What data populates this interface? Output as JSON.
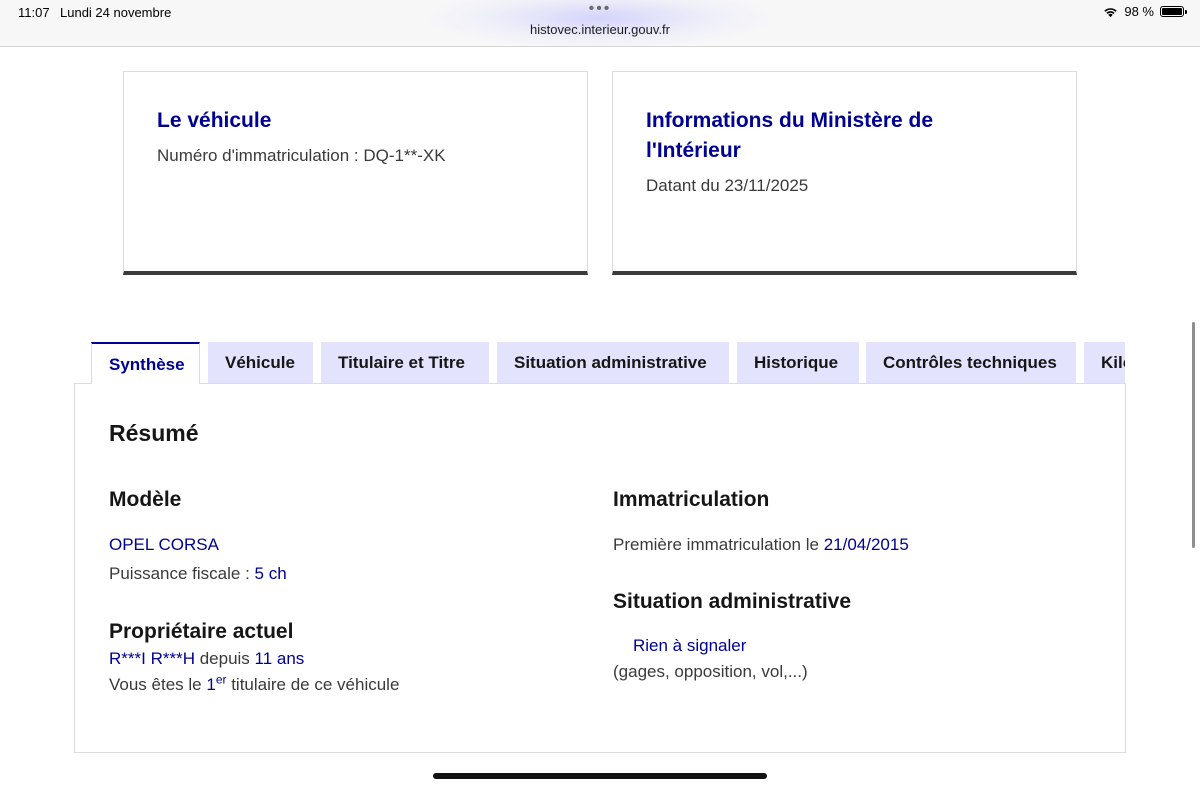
{
  "status_bar": {
    "time": "11:07",
    "date": "Lundi 24 novembre",
    "dots": "•••",
    "url": "histovec.interieur.gouv.fr",
    "battery_text": "98 %",
    "battery_level": 0.98,
    "wifi_icon": "wifi-icon",
    "battery_icon": "battery-icon"
  },
  "cards": {
    "vehicle": {
      "title": "Le véhicule",
      "plate_label": "Numéro d'immatriculation : DQ-1**-XK"
    },
    "ministry": {
      "title": "Informations du Ministère de l'Intérieur",
      "date_label": "Datant du 23/11/2025"
    }
  },
  "tabs": [
    {
      "label": "Synthèse",
      "active": true
    },
    {
      "label": "Véhicule",
      "active": false
    },
    {
      "label": "Titulaire et Titre",
      "active": false
    },
    {
      "label": "Situation administrative",
      "active": false
    },
    {
      "label": "Historique",
      "active": false
    },
    {
      "label": "Contrôles techniques",
      "active": false
    },
    {
      "label": "Kilométrage",
      "active": false
    }
  ],
  "synthese": {
    "heading": "Résumé",
    "model": {
      "heading": "Modèle",
      "name": "OPEL CORSA",
      "power_label": "Puissance fiscale : ",
      "power_value": "5 ch"
    },
    "owner": {
      "heading": "Propriétaire actuel",
      "name": "R***I R***H",
      "since_label": " depuis ",
      "since_value": "11 ans",
      "rank_prefix": "Vous êtes le ",
      "rank_number": "1",
      "rank_sup": "er",
      "rank_suffix": " titulaire de ce véhicule"
    },
    "registration": {
      "heading": "Immatriculation",
      "first_label": "Première immatriculation le ",
      "first_date": "21/04/2015"
    },
    "admin": {
      "heading": "Situation administrative",
      "status": "Rien à signaler",
      "detail": "(gages, opposition, vol,...)"
    }
  },
  "colors": {
    "primary_blue": "#000091",
    "tab_background": "#e3e3fd",
    "text": "#3a3a3a"
  }
}
